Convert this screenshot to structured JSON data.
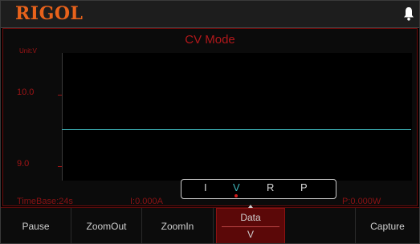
{
  "header": {
    "brand": "RIGOL",
    "notification_icon": "bell-icon"
  },
  "graph": {
    "mode_title": "CV Mode",
    "unit_label": "Unit:V",
    "y_ticks": [
      "10.0",
      "9.0"
    ],
    "trace_color": "#3fb6bb"
  },
  "status": {
    "timebase": "TimeBase:24s",
    "current": "I:0.000A",
    "power": "P:0.000W"
  },
  "selector": {
    "items": [
      "I",
      "V",
      "R",
      "P"
    ],
    "selected": "V"
  },
  "softkeys": {
    "pause": "Pause",
    "zoom_out": "ZoomOut",
    "zoom_in": "ZoomIn",
    "data": "Data",
    "data_value": "V",
    "capture": "Capture"
  },
  "colors": {
    "brand": "#e8621b",
    "accent_red": "#b1181b",
    "trace": "#3fb6bb"
  }
}
